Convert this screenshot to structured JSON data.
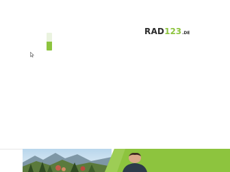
{
  "brand": {
    "logo_part1": "RAD",
    "logo_part2": "123",
    "logo_part3": ".DE",
    "colors": {
      "dark": "#2b2b2b",
      "accent": "#8dc43e",
      "accent_light": "#eaf3df"
    }
  },
  "loader": {
    "progress": 0.5
  },
  "icons": {
    "cursor": "mouse-pointer-icon"
  }
}
